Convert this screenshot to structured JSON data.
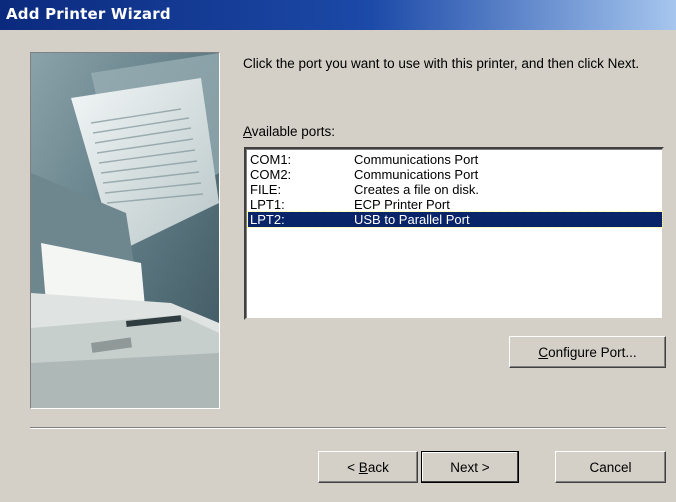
{
  "window": {
    "title": "Add Printer Wizard"
  },
  "instruction": "Click the port you want to use with this printer, and then click Next.",
  "ports_label": {
    "accel": "A",
    "rest": "vailable ports:"
  },
  "ports": [
    {
      "port": "COM1:",
      "description": "Communications Port"
    },
    {
      "port": "COM2:",
      "description": "Communications Port"
    },
    {
      "port": "FILE:",
      "description": "Creates a file on disk."
    },
    {
      "port": "LPT1:",
      "description": "ECP Printer Port"
    },
    {
      "port": "LPT2:",
      "description": "USB to Parallel Port"
    }
  ],
  "selected_port": "LPT2:",
  "buttons": {
    "configure": {
      "accel": "C",
      "rest": "onfigure Port..."
    },
    "back": {
      "prefix": "< ",
      "accel": "B",
      "rest": "ack"
    },
    "next": "Next >",
    "cancel": "Cancel"
  },
  "colors": {
    "selection": "#0a246a",
    "face": "#d4d0c8",
    "title_start": "#0b2a7e"
  }
}
